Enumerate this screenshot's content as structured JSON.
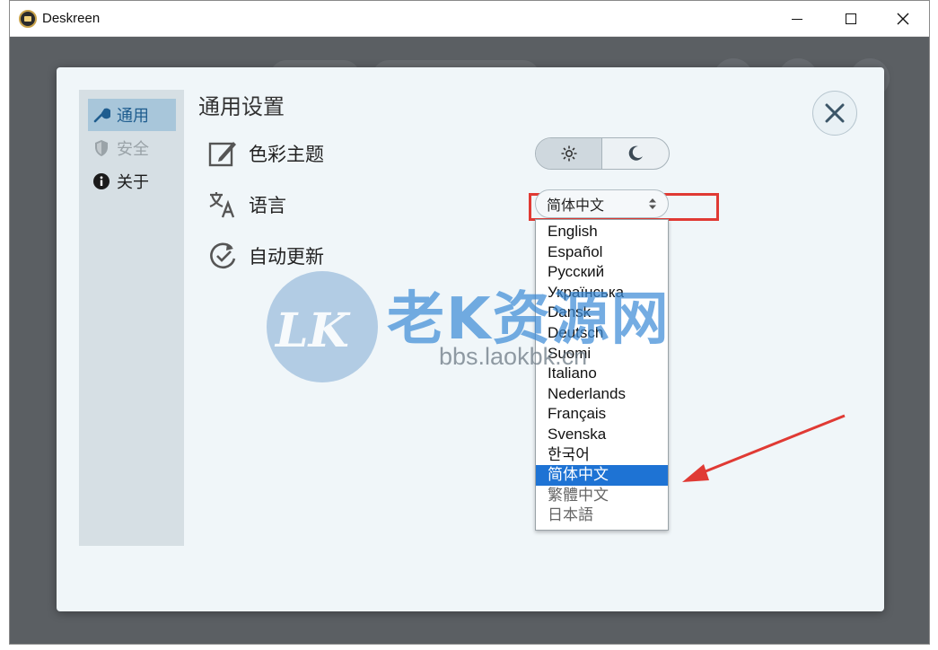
{
  "window": {
    "title": "Deskreen"
  },
  "sidebar": {
    "items": [
      {
        "label": "通用",
        "icon": "wrench-icon",
        "state": "active"
      },
      {
        "label": "安全",
        "icon": "shield-icon",
        "state": "disabled"
      },
      {
        "label": "关于",
        "icon": "info-icon",
        "state": "normal"
      }
    ]
  },
  "dialog": {
    "title": "通用设置",
    "rows": {
      "theme": {
        "label": "色彩主题",
        "icon": "edit-icon"
      },
      "language": {
        "label": "语言",
        "icon": "translate-icon"
      },
      "update": {
        "label": "自动更新",
        "icon": "refresh-check-icon"
      }
    },
    "theme_toggle": {
      "options": [
        "light",
        "dark"
      ],
      "selected": "light"
    },
    "language_select": {
      "value": "简体中文",
      "options": [
        "English",
        "Español",
        "Русский",
        "Українська",
        "Dansk",
        "Deutsch",
        "Suomi",
        "Italiano",
        "Nederlands",
        "Français",
        "Svenska",
        "한국어",
        "简体中文",
        "繁體中文",
        "日本語"
      ],
      "highlighted": "简体中文"
    }
  },
  "watermark": {
    "logo_text": "LK",
    "title": "老K资源网",
    "site": "bbs.laokbk.cn"
  },
  "colors": {
    "accent": "#1e73d4",
    "annotation": "#e03a34",
    "sidebar_active": "#a8c6da"
  }
}
